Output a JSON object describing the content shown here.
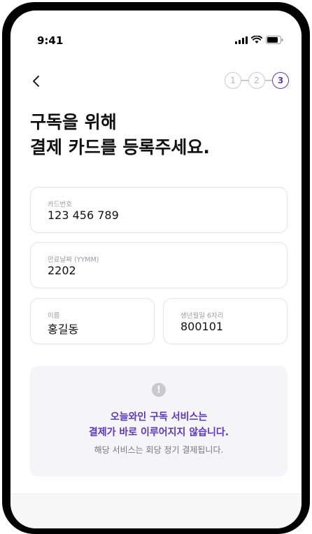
{
  "status": {
    "time": "9:41"
  },
  "steps": [
    "1",
    "2",
    "3"
  ],
  "title": {
    "line1": "구독을 위해",
    "line2": "결제 카드를 등록주세요."
  },
  "fields": {
    "card_number": {
      "label": "카드번호",
      "value": "123 456 789"
    },
    "expiry": {
      "label": "만료날짜 (YYMM)",
      "value": "2202"
    },
    "name": {
      "label": "이름",
      "value": "홍길동"
    },
    "birth": {
      "label": "생년월일 6자리",
      "value": "800101"
    }
  },
  "notice": {
    "line1": "오늘와인 구독 서비스는",
    "line2": "결제가 바로 이루어지지 않습니다.",
    "line3": "해당 서비스는 회당 정기 결제됩니다."
  },
  "colors": {
    "accent": "#5a38c4",
    "border": "#e3e3e8",
    "notice_bg": "#f5f5f7"
  }
}
